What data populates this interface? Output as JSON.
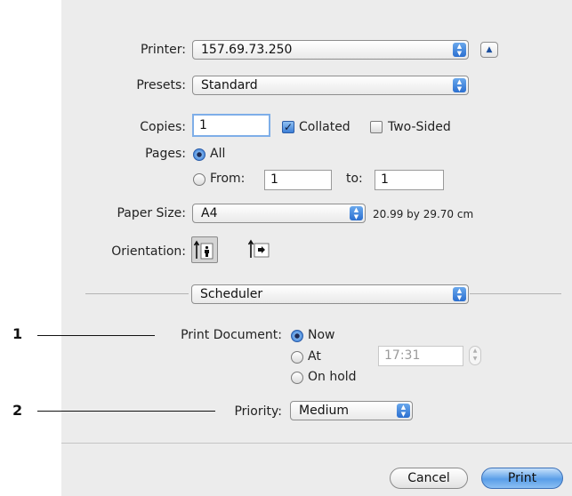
{
  "printer": {
    "label": "Printer:",
    "value": "157.69.73.250"
  },
  "presets": {
    "label": "Presets:",
    "value": "Standard"
  },
  "copies": {
    "label": "Copies:",
    "value": "1",
    "collated_label": "Collated",
    "collated_checked": true,
    "two_sided_label": "Two-Sided",
    "two_sided_checked": false
  },
  "pages": {
    "label": "Pages:",
    "all_label": "All",
    "from_label": "From:",
    "from_value": "1",
    "to_label": "to:",
    "to_value": "1"
  },
  "paper_size": {
    "label": "Paper Size:",
    "value": "A4",
    "dimensions": "20.99 by 29.70 cm"
  },
  "orientation": {
    "label": "Orientation:"
  },
  "section": {
    "value": "Scheduler"
  },
  "print_document": {
    "label": "Print Document:",
    "now_label": "Now",
    "at_label": "At",
    "time_value": "17:31",
    "on_hold_label": "On hold"
  },
  "priority": {
    "label": "Priority:",
    "value": "Medium"
  },
  "buttons": {
    "cancel": "Cancel",
    "print": "Print"
  },
  "callouts": {
    "one": "1",
    "two": "2"
  },
  "colors": {
    "accent": "#3c7fd6",
    "panel_bg": "#ececec"
  }
}
